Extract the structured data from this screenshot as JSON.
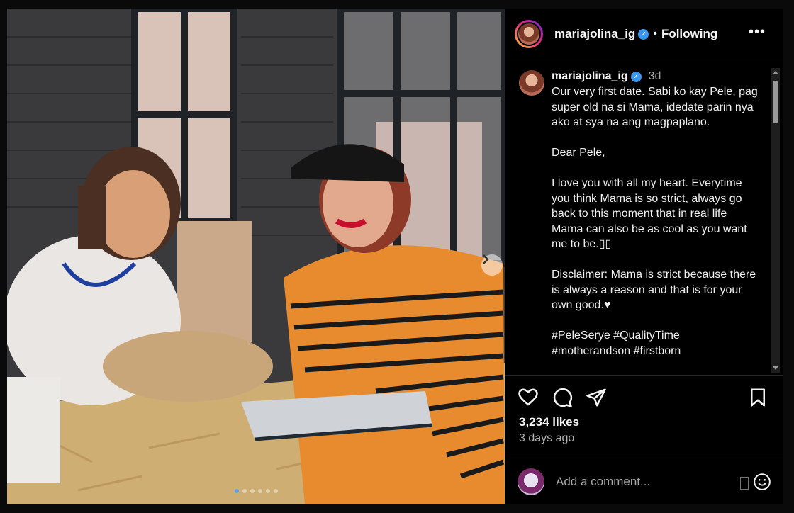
{
  "post": {
    "username": "mariajolina_ig",
    "follow_separator": "•",
    "follow_label": "Following",
    "more_label": "•••",
    "time_short": "3d",
    "caption_paragraphs": [
      "Our very first date. Sabi ko kay Pele, pag super old na si Mama, idedate parin nya ako at sya na ang magpaplano.",
      "Dear Pele,",
      "I love you with all my heart. Everytime you think Mama is so strict, always go back to this moment that in real life Mama can also be as cool as you want me to be.▯▯",
      "Disclaimer: Mama is strict because there is always a reason and that is for your own good.♥",
      "#PeleSerye #QualityTime\n#motherandson #firstborn"
    ],
    "likes": "3,234 likes",
    "time_ago": "3 days ago",
    "comment_placeholder": "Add a comment..."
  },
  "icons": {
    "like": "heart-icon",
    "comment": "comment-icon",
    "share": "send-icon",
    "save": "bookmark-icon",
    "emoji": "emoji-icon",
    "next": "chevron-right-icon"
  },
  "carousel": {
    "slides": 6,
    "current_index": 0
  },
  "colors": {
    "verified": "#3897f0",
    "background": "#000000",
    "text_muted": "#a8a8a8"
  }
}
